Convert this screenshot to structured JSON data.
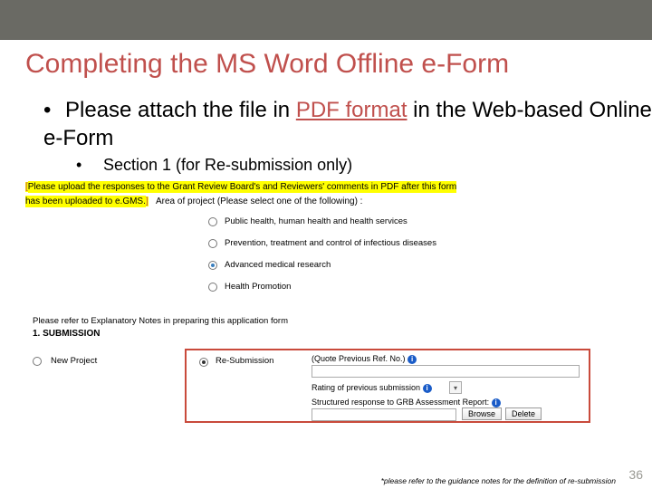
{
  "topBar": "",
  "title": "Completing the MS Word Offline e-Form",
  "bullet1_pre": "Please attach the file in ",
  "bullet1_pdf": "PDF format",
  "bullet1_post": " in the Web-based Online e-Form",
  "bullet2": "Section 1 (for Re-submission only)",
  "hl_pre": "[",
  "hl_body1": "Please upload the responses to the Grant Review Board's and Reviewers' comments in PDF after this form",
  "hl_body2": "has been uploaded to e.GMS.",
  "hl_post": "]",
  "areaLabel": "Area of project (Please select one of the following) :",
  "opt1": "Public health, human health and health services",
  "opt2": "Prevention, treatment and control of infectious diseases",
  "opt3": "Advanced medical research",
  "opt4": "Health Promotion",
  "noteText": "Please refer to Explanatory Notes in preparing this application form",
  "submHeader": "1. SUBMISSION",
  "newProject": "New Project",
  "reSubmission": "Re-Submission",
  "quoteLabel": "(Quote Previous Ref. No.)",
  "ratingLabel": "Rating of previous submission",
  "structLabel": "Structured response to GRB Assessment Report:",
  "browse": "Browse",
  "delete": "Delete",
  "footnote": "*please refer to the guidance notes for the definition of re-submission",
  "pageNum": "36"
}
